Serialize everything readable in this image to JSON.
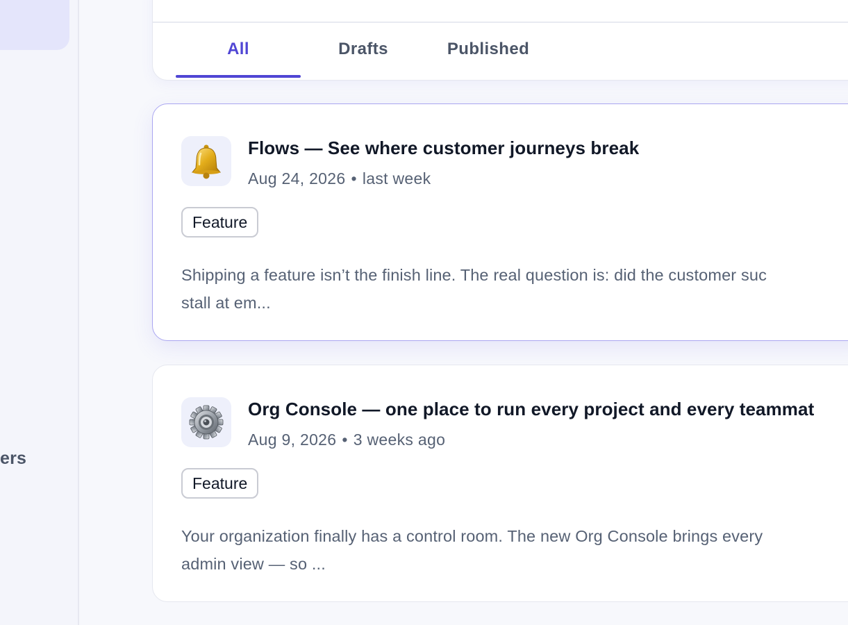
{
  "sidebar": {
    "partial_label": "ers"
  },
  "tabs": [
    {
      "label": "All",
      "active": true
    },
    {
      "label": "Drafts",
      "active": false
    },
    {
      "label": "Published",
      "active": false
    }
  ],
  "posts": [
    {
      "icon": "bell-icon",
      "title": "Flows — See where customer journeys break",
      "date": "Aug 24, 2026",
      "relative": "last week",
      "tag": "Feature",
      "excerpt_line1": "Shipping a feature isn’t the finish line. The real question is: did the customer suc",
      "excerpt_line2": "stall at em...",
      "selected": true
    },
    {
      "icon": "gear-icon",
      "title": "Org Console — one place to run every project and every teammat",
      "date": "Aug 9, 2026",
      "relative": "3 weeks ago",
      "tag": "Feature",
      "excerpt_line1": "Your organization finally has a control room. The new Org Console brings every",
      "excerpt_line2": "admin view — so ...",
      "selected": false
    }
  ],
  "colors": {
    "accent": "#5046d4",
    "selected_border": "#aaa6f1"
  }
}
